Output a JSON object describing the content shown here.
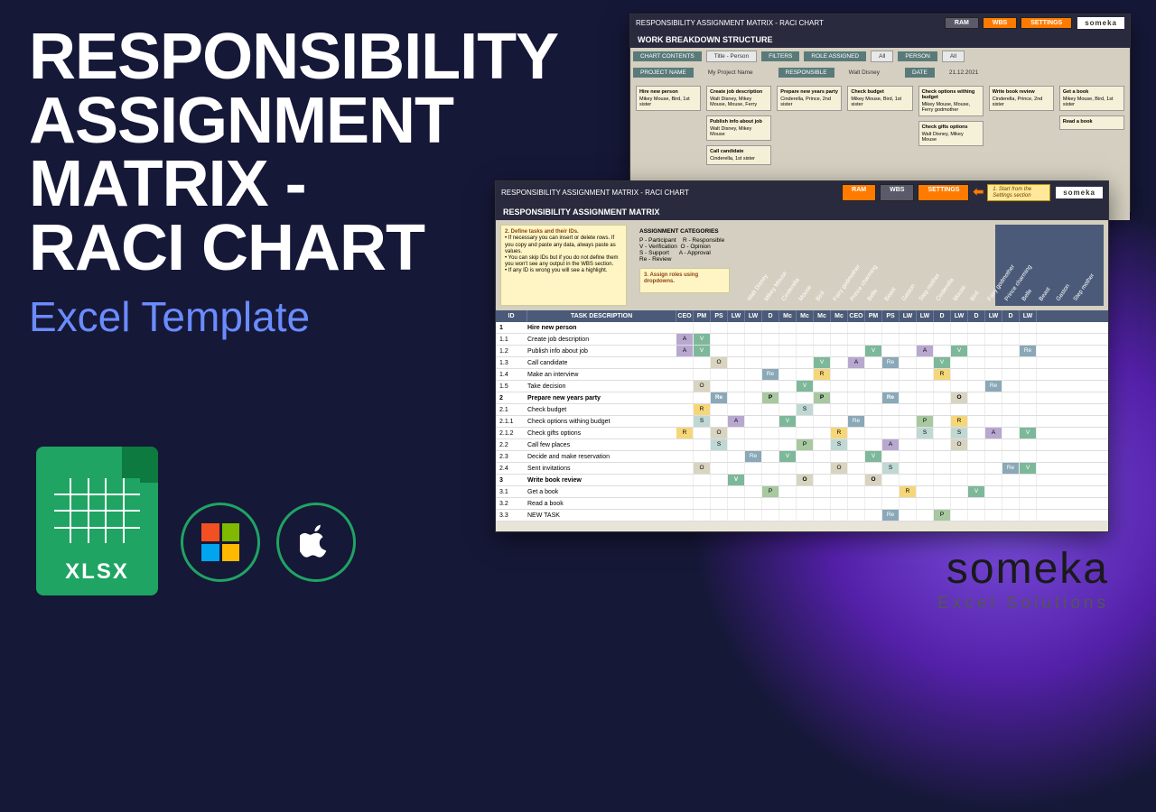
{
  "title": {
    "line1": "RESPONSIBILITY",
    "line2": "ASSIGNMENT",
    "line3": "MATRIX -",
    "line4": "RACI CHART"
  },
  "subtitle": "Excel Template",
  "xlsx": "XLSX",
  "brand": {
    "name": "someka",
    "sub": "Excel Solutions"
  },
  "header_chart": "RESPONSIBILITY ASSIGNMENT MATRIX - RACI CHART",
  "wbs_title": "WORK BREAKDOWN STRUCTURE",
  "ram_title": "RESPONSIBILITY ASSIGNMENT MATRIX",
  "btns": {
    "ram": "RAM",
    "wbs": "WBS",
    "settings": "SETTINGS"
  },
  "hint": "1. Start from the Settings section",
  "filters": {
    "cc": "CHART CONTENTS",
    "tp": "Title - Person",
    "flt": "FILTERS",
    "ra": "ROLE ASSIGNED",
    "all1": "All",
    "person": "PERSON",
    "all2": "All"
  },
  "info": {
    "pn": "PROJECT NAME",
    "pnv": "My Project Name",
    "resp": "RESPONSIBLE",
    "respv": "Walt Disney",
    "date": "DATE",
    "datev": "21.12.2021"
  },
  "wbs_cards": [
    [
      {
        "t": "Hire new person",
        "p": "Mikey Mouse, Bird, 1st sister"
      }
    ],
    [
      {
        "t": "Create job description",
        "p": "Walt Disney, Mikey Mouse, Mouse, Ferry"
      },
      {
        "t": "Publish info about job",
        "p": "Walt Disney, Mikey Mouse"
      },
      {
        "t": "Call candidate",
        "p": "Cinderella, 1st sister"
      }
    ],
    [
      {
        "t": "Prepare new years party",
        "p": "Cinderella, Prince, 2nd sister"
      }
    ],
    [
      {
        "t": "Check budget",
        "p": "Mikey Mouse, Bird, 1st sister"
      }
    ],
    [
      {
        "t": "Check options withing budget",
        "p": "Mikey Mouse, Mouse, Ferry godmother"
      },
      {
        "t": "Check gifts options",
        "p": "Walt Disney, Mikey Mouse"
      }
    ],
    [
      {
        "t": "Write book review",
        "p": "Cinderella, Prince, 2nd sister"
      }
    ],
    [
      {
        "t": "Get a book",
        "p": "Mikey Mouse, Bird, 1st sister"
      },
      {
        "t": "Read a book",
        "p": ""
      }
    ]
  ],
  "instruct": {
    "t": "2. Define tasks and their IDs.",
    "b1": "If necessary you can insert or delete rows. If you copy and paste any data, always paste as values.",
    "b2": "You can skip IDs but if you do not define them you won't see any output in the WBS section.",
    "b3": "If any ID is wrong you will see a highlight."
  },
  "instruct3": "3. Assign roles using dropdowns.",
  "cat": {
    "h": "ASSIGNMENT CATEGORIES",
    "p": "P - Participant",
    "r": "R - Responsible",
    "v": "V - Verification",
    "o": "O - Opinion",
    "s": "S - Support",
    "a": "A - Approval",
    "re": "Re - Review"
  },
  "diag": [
    "Walt Disney",
    "Mikey Mouse",
    "Cinderella",
    "Mouse",
    "Bird",
    "Fairy godmother",
    "Prince charming",
    "Belle",
    "Beast",
    "Gaston",
    "Step mother",
    "Cinderella",
    "Mouse",
    "Bird",
    "Fairy godmother",
    "Prince charming",
    "Belle",
    "Beast",
    "Gaston",
    "Step mother"
  ],
  "cols": [
    "ID",
    "TASK DESCRIPTION",
    "CEO",
    "PM",
    "PS",
    "LW",
    "LW",
    "D",
    "Mc",
    "Mc",
    "Mc",
    "Mc",
    "CEO",
    "PM",
    "PS",
    "LW",
    "LW",
    "D",
    "LW",
    "D",
    "LW",
    "D",
    "LW"
  ],
  "rows": [
    {
      "id": "1",
      "task": "Hire new person",
      "bold": true,
      "cells": [
        "",
        "",
        "",
        "",
        "",
        "",
        "",
        "",
        "",
        "",
        "",
        "",
        "",
        "",
        "",
        "",
        "",
        "",
        "",
        "",
        ""
      ]
    },
    {
      "id": "1.1",
      "task": "Create job description",
      "cells": [
        "A",
        "V",
        "",
        "",
        "",
        "",
        "",
        "",
        "",
        "",
        "",
        "",
        "",
        "",
        "",
        "",
        "",
        "",
        "",
        "",
        ""
      ]
    },
    {
      "id": "1.2",
      "task": "Publish info about job",
      "cells": [
        "A",
        "V",
        "",
        "",
        "",
        "",
        "",
        "",
        "",
        "",
        "",
        "V",
        "",
        "",
        "A",
        "",
        "V",
        "",
        "",
        "",
        "Re"
      ]
    },
    {
      "id": "1.3",
      "task": "Call candidate",
      "cells": [
        "",
        "",
        "O",
        "",
        "",
        "",
        "",
        "",
        "V",
        "",
        "A",
        "",
        "Re",
        "",
        "",
        "V",
        "",
        "",
        "",
        "",
        ""
      ]
    },
    {
      "id": "1.4",
      "task": "Make an interview",
      "cells": [
        "",
        "",
        "",
        "",
        "",
        "Re",
        "",
        "",
        "R",
        "",
        "",
        "",
        "",
        "",
        "",
        "R",
        "",
        "",
        "",
        "",
        ""
      ]
    },
    {
      "id": "1.5",
      "task": "Take decision",
      "cells": [
        "",
        "O",
        "",
        "",
        "",
        "",
        "",
        "V",
        "",
        "",
        "",
        "",
        "",
        "",
        "",
        "",
        "",
        "",
        "Re",
        "",
        ""
      ]
    },
    {
      "id": "2",
      "task": "Prepare new years party",
      "bold": true,
      "cells": [
        "",
        "",
        "Re",
        "",
        "",
        "P",
        "",
        "",
        "P",
        "",
        "",
        "",
        "Re",
        "",
        "",
        "",
        "O",
        "",
        "",
        "",
        ""
      ]
    },
    {
      "id": "2.1",
      "task": "Check budget",
      "cells": [
        "",
        "R",
        "",
        "",
        "",
        "",
        "",
        "S",
        "",
        "",
        "",
        "",
        "",
        "",
        "",
        "",
        "",
        "",
        "",
        "",
        ""
      ]
    },
    {
      "id": "2.1.1",
      "task": "Check options withing budget",
      "cells": [
        "",
        "S",
        "",
        "A",
        "",
        "",
        "V",
        "",
        "",
        "",
        "Re",
        "",
        "",
        "",
        "P",
        "",
        "R",
        "",
        "",
        "",
        ""
      ]
    },
    {
      "id": "2.1.2",
      "task": "Check gifts options",
      "cells": [
        "R",
        "",
        "O",
        "",
        "",
        "",
        "",
        "",
        "",
        "R",
        "",
        "",
        "",
        "",
        "S",
        "",
        "S",
        "",
        "A",
        "",
        "V"
      ]
    },
    {
      "id": "2.2",
      "task": "Call few places",
      "cells": [
        "",
        "",
        "S",
        "",
        "",
        "",
        "",
        "P",
        "",
        "S",
        "",
        "",
        "A",
        "",
        "",
        "",
        "O",
        "",
        "",
        "",
        ""
      ]
    },
    {
      "id": "2.3",
      "task": "Decide and make reservation",
      "cells": [
        "",
        "",
        "",
        "",
        "Re",
        "",
        "V",
        "",
        "",
        "",
        "",
        "V",
        "",
        "",
        "",
        "",
        "",
        "",
        "",
        "",
        ""
      ]
    },
    {
      "id": "2.4",
      "task": "Sent invitations",
      "cells": [
        "",
        "O",
        "",
        "",
        "",
        "",
        "",
        "",
        "",
        "O",
        "",
        "",
        "S",
        "",
        "",
        "",
        "",
        "",
        "",
        "Re",
        "V"
      ]
    },
    {
      "id": "3",
      "task": "Write book review",
      "bold": true,
      "cells": [
        "",
        "",
        "",
        "V",
        "",
        "",
        "",
        "O",
        "",
        "",
        "",
        "O",
        "",
        "",
        "",
        "",
        "",
        "",
        "",
        "",
        ""
      ]
    },
    {
      "id": "3.1",
      "task": "Get a book",
      "cells": [
        "",
        "",
        "",
        "",
        "",
        "P",
        "",
        "",
        "",
        "",
        "",
        "",
        "",
        "R",
        "",
        "",
        "",
        "V",
        "",
        "",
        ""
      ]
    },
    {
      "id": "3.2",
      "task": "Read a book",
      "cells": [
        "",
        "",
        "",
        "",
        "",
        "",
        "",
        "",
        "",
        "",
        "",
        "",
        "",
        "",
        "",
        "",
        "",
        "",
        "",
        "",
        ""
      ]
    },
    {
      "id": "3.3",
      "task": "NEW TASK",
      "cells": [
        "",
        "",
        "",
        "",
        "",
        "",
        "",
        "",
        "",
        "",
        "",
        "",
        "Re",
        "",
        "",
        "P",
        "",
        "",
        "",
        "",
        ""
      ]
    }
  ]
}
